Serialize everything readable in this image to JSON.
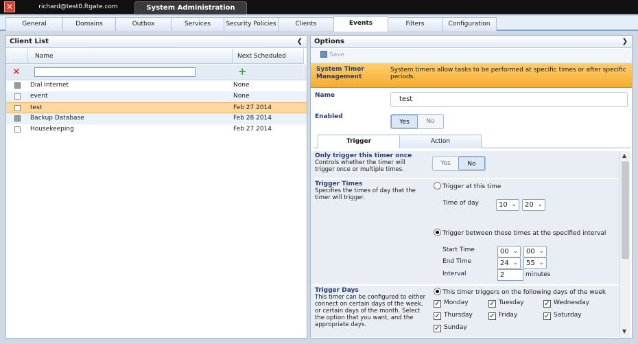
{
  "titlebar": {
    "user": "richard@test0.ftgate.com",
    "active_tab": "System Administration"
  },
  "tabs": [
    {
      "label": "General"
    },
    {
      "label": "Domains"
    },
    {
      "label": "Outbox"
    },
    {
      "label": "Services"
    },
    {
      "label": "Security Policies"
    },
    {
      "label": "Clients"
    },
    {
      "label": "Events"
    },
    {
      "label": "Filters"
    },
    {
      "label": "Configuration"
    }
  ],
  "client_list": {
    "title": "Client List",
    "col_name": "Name",
    "col_next": "Next Scheduled",
    "filter_value": "",
    "rows": [
      {
        "name": "Dial Internet",
        "next": "None"
      },
      {
        "name": "event",
        "next": "None"
      },
      {
        "name": "test",
        "next": "Feb 27 2014"
      },
      {
        "name": "Backup Database",
        "next": "Feb 28 2014"
      },
      {
        "name": "Housekeeping",
        "next": "Feb 27 2014"
      }
    ]
  },
  "options": {
    "title": "Options",
    "save_label": "Save",
    "banner_title": "System Timer Management",
    "banner_desc": "System timers allow tasks to be performed at specific times or after specific periods.",
    "name_label": "Name",
    "name_value": "test",
    "enabled_label": "Enabled",
    "enabled_yes": "Yes",
    "enabled_no": "No",
    "tabs": {
      "trigger": "Trigger",
      "action": "Action"
    },
    "once": {
      "title": "Only trigger this timer once",
      "desc": "Controls whether the timer will trigger once or multiple times.",
      "yes": "Yes",
      "no": "No"
    },
    "times": {
      "title": "Trigger Times",
      "desc": "Specifies the times of day that the timer will trigger.",
      "opt_at": "Trigger at this time",
      "time_of_day_label": "Time of day",
      "tod_hour": "10",
      "tod_min": "20",
      "opt_between": "Trigger between these times at the specified interval",
      "start_label": "Start Time",
      "start_hour": "00",
      "start_min": "00",
      "end_label": "End Time",
      "end_hour": "24",
      "end_min": "55",
      "interval_label": "Interval",
      "interval_value": "2",
      "interval_unit": "minutes"
    },
    "days": {
      "title": "Trigger Days",
      "desc": "This timer can be configured to either connect on certain days of the week, or certain days of the month. Select the option that you want, and the appropriate days.",
      "opt_week": "This timer triggers on the following days of the week",
      "monday": "Monday",
      "tuesday": "Tuesday",
      "wednesday": "Wednesday",
      "thursday": "Thursday",
      "friday": "Friday",
      "saturday": "Saturday",
      "sunday": "Sunday"
    }
  },
  "icons": {
    "close": "close-icon",
    "collapse": "chevron-left-icon",
    "expand": "chevron-right-icon",
    "delete": "delete-icon",
    "add": "plus-icon",
    "save": "save-icon"
  },
  "colors": {
    "banner": "#f6ab2d",
    "selected_row": "#fdd9a0",
    "accent": "#2a3a70"
  }
}
